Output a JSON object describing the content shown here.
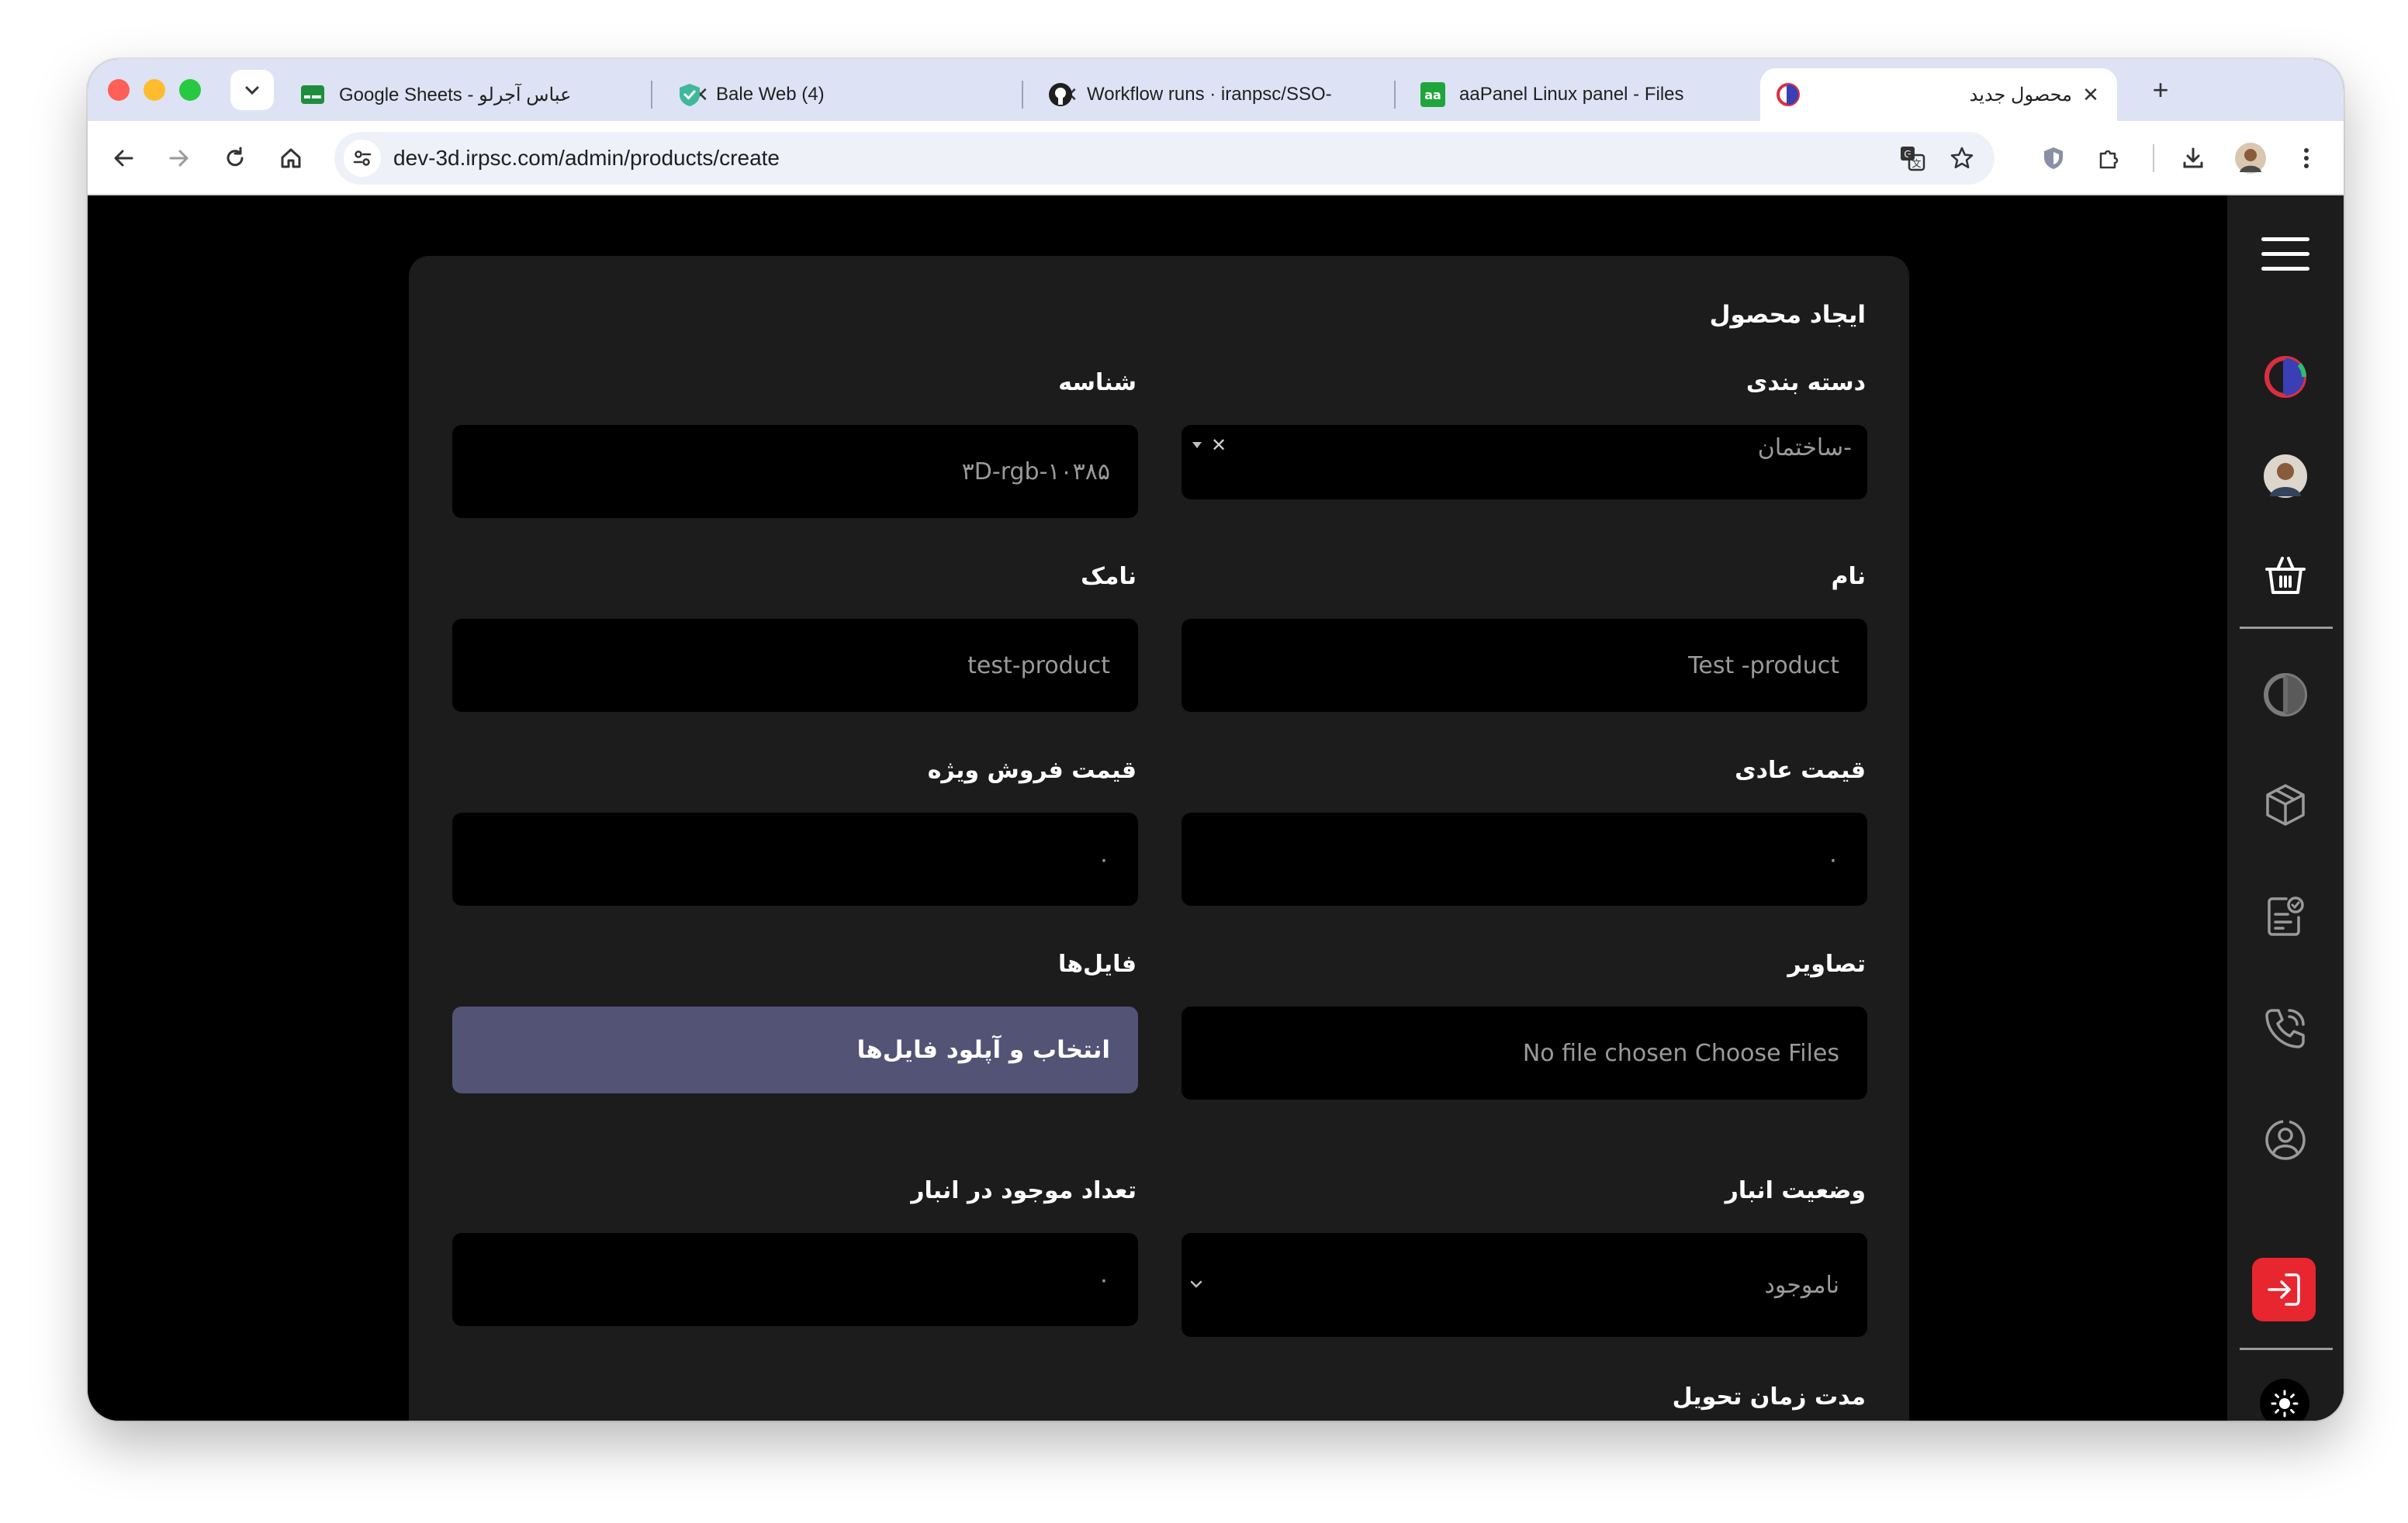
{
  "browser": {
    "tabs": [
      {
        "title": "Google Sheets - عباس آجرلو",
        "icon": "google-sheets-icon"
      },
      {
        "title": "Bale Web (4)",
        "icon": "bale-icon"
      },
      {
        "title": "Workflow runs · iranpsc/SSO-",
        "icon": "github-icon"
      },
      {
        "title": "aaPanel Linux panel - Files",
        "icon": "aapanel-icon"
      },
      {
        "title": "محصول جدید",
        "icon": "site-logo-icon",
        "active": true
      }
    ],
    "url": "dev-3d.irpsc.com/admin/products/create"
  },
  "page": {
    "title": "ایجاد محصول",
    "fields": {
      "category": {
        "label": "دسته بندی",
        "value": "-ساختمان"
      },
      "sku": {
        "label": "شناسه",
        "value": "۳D-rgb-۱۰۳۸۵"
      },
      "name": {
        "label": "نام",
        "value": "Test -product"
      },
      "slug": {
        "label": "نامک",
        "value": "test-product"
      },
      "regular_price": {
        "label": "قیمت عادی",
        "value": "۰"
      },
      "sale_price": {
        "label": "قیمت فروش ویژه",
        "value": "۰"
      },
      "images": {
        "label": "تصاویر",
        "value": "No file chosen Choose Files"
      },
      "files": {
        "label": "فایل‌ها",
        "button": "انتخاب و آپلود فایل‌ها"
      },
      "stock_status": {
        "label": "وضعیت انبار",
        "value": "ناموجود"
      },
      "stock_qty": {
        "label": "تعداد موجود در انبار",
        "value": "۰"
      },
      "delivery_time": {
        "label": "مدت زمان تحویل"
      }
    }
  },
  "sidebar": {
    "items": [
      "menu-icon",
      "site-logo-icon",
      "avatar",
      "basket-icon",
      "3d-logo-icon",
      "cube-icon",
      "task-icon",
      "phone-icon",
      "user-circle-icon",
      "logout-icon",
      "sun-icon"
    ]
  },
  "colors": {
    "upload_button": "#525375",
    "logout": "#e8262f",
    "card_bg": "#1c1c1c",
    "field_bg": "#000000"
  }
}
